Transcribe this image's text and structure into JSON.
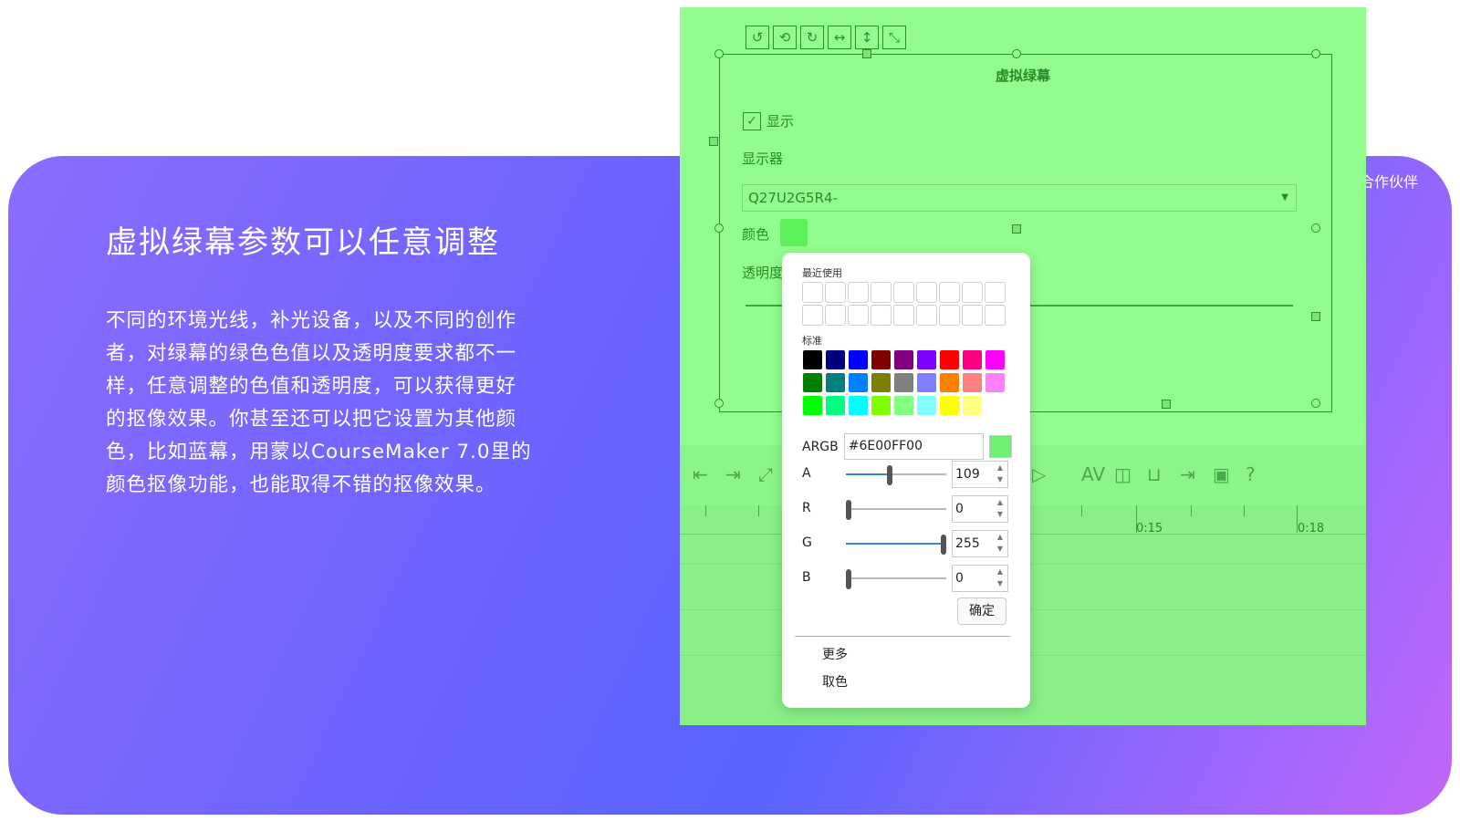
{
  "promo": {
    "top_right_text": "合作伙伴",
    "headline": "虚拟绿幕参数可以任意调整",
    "description_lines": [
      "不同的环境光线，补光设备，以及不同的创作",
      "者，对绿幕的绿色色值以及透明度要求都不一",
      "样，任意调整的色值和透明度，可以获得更好",
      "的抠像效果。你甚至还可以把它设置为其他颜",
      "色，比如蓝幕，用蒙以CourseMaker  7.0里的",
      "颜色抠像功能，也能取得不错的抠像效果。"
    ]
  },
  "dialog": {
    "title": "虚拟绿幕",
    "show_label": "显示",
    "show_checked": true,
    "monitor_label": "显示器",
    "monitor_value": "Q27U2G5R4-",
    "color_label": "颜色",
    "opacity_label": "透明度",
    "color_value": "#5ef058"
  },
  "timeline": {
    "labels": [
      "0:15",
      "0:18"
    ]
  },
  "color_picker": {
    "recent_label": "最近使用",
    "standard_label": "标准",
    "standard_colors": [
      "#000000",
      "#000080",
      "#0000ff",
      "#800000",
      "#800080",
      "#8000ff",
      "#ff0000",
      "#ff0080",
      "#ff00ff",
      "#008000",
      "#008080",
      "#0080ff",
      "#808000",
      "#808080",
      "#8080ff",
      "#ff8000",
      "#ff8080",
      "#ff80ff",
      "#00ff00",
      "#00ff80",
      "#00ffff",
      "#80ff00",
      "#80ff80",
      "#80ffff",
      "#ffff00",
      "#ffff80",
      "#ffffff"
    ],
    "argb_label": "ARGB",
    "argb_value": "#6E00FF00",
    "preview_color": "#6ef16e",
    "channels": [
      {
        "label": "A",
        "value": "109",
        "fraction": 0.43
      },
      {
        "label": "R",
        "value": "0",
        "fraction": 0.0
      },
      {
        "label": "G",
        "value": "255",
        "fraction": 1.0
      },
      {
        "label": "B",
        "value": "0",
        "fraction": 0.0
      }
    ],
    "ok_label": "确定",
    "more_label": "更多",
    "pick_label": "取色"
  }
}
